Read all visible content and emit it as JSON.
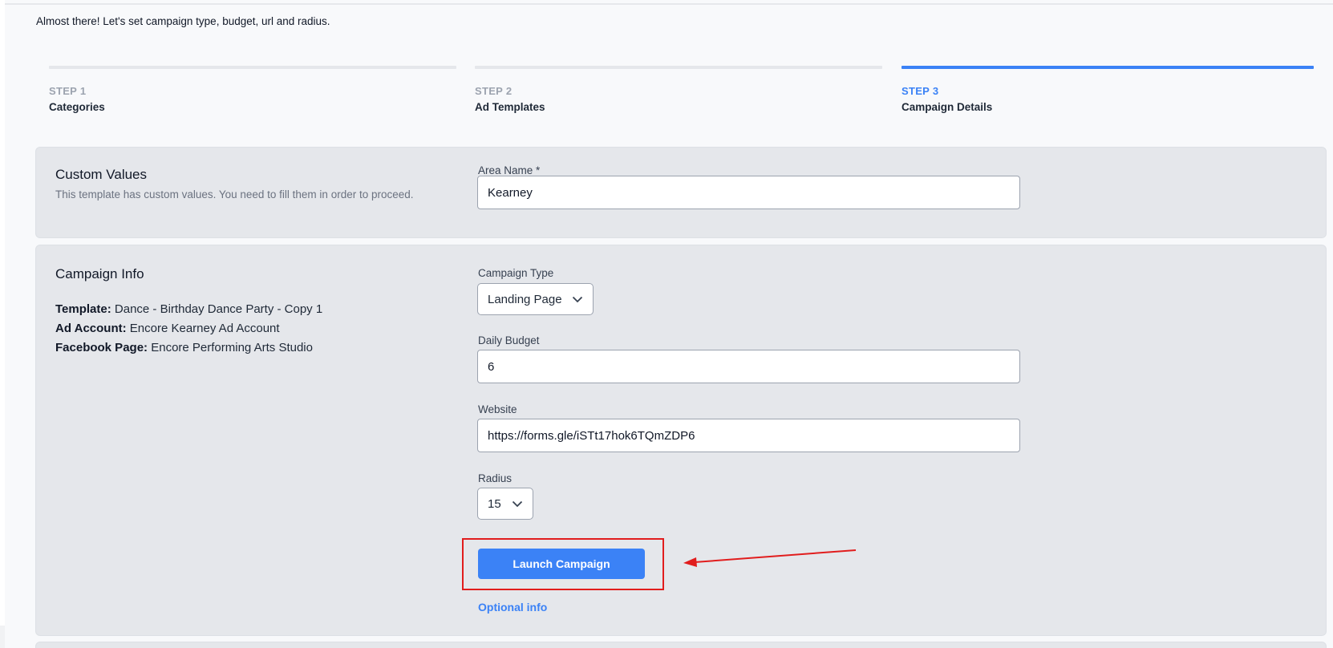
{
  "intro": "Almost there! Let's set campaign type, budget, url and radius.",
  "steps": [
    {
      "number": "STEP 1",
      "title": "Categories",
      "active": false
    },
    {
      "number": "STEP 2",
      "title": "Ad Templates",
      "active": false
    },
    {
      "number": "STEP 3",
      "title": "Campaign Details",
      "active": true
    }
  ],
  "custom_values": {
    "title": "Custom Values",
    "description": "This template has custom values. You need to fill them in order to proceed.",
    "area_name_label": "Area Name *",
    "area_name_value": "Kearney"
  },
  "campaign_info": {
    "title": "Campaign Info",
    "template_label": "Template:",
    "template_value": "Dance - Birthday Dance Party - Copy 1",
    "ad_account_label": "Ad Account:",
    "ad_account_value": "Encore Kearney Ad Account",
    "facebook_page_label": "Facebook Page:",
    "facebook_page_value": "Encore Performing Arts Studio",
    "campaign_type_label": "Campaign Type",
    "campaign_type_value": "Landing Page",
    "daily_budget_label": "Daily Budget",
    "daily_budget_value": "6",
    "website_label": "Website",
    "website_value": "https://forms.gle/iSTt17hok6TQmZDP6",
    "radius_label": "Radius",
    "radius_value": "15",
    "launch_label": "Launch Campaign",
    "optional_label": "Optional info"
  },
  "icons": {
    "dropdown": "chevron-down-icon",
    "annotation": "red-arrow"
  },
  "colors": {
    "accent": "#3b82f6",
    "annotation": "#e11d1d",
    "card": "#e5e7eb",
    "inactive_step": "#9ca3af"
  }
}
